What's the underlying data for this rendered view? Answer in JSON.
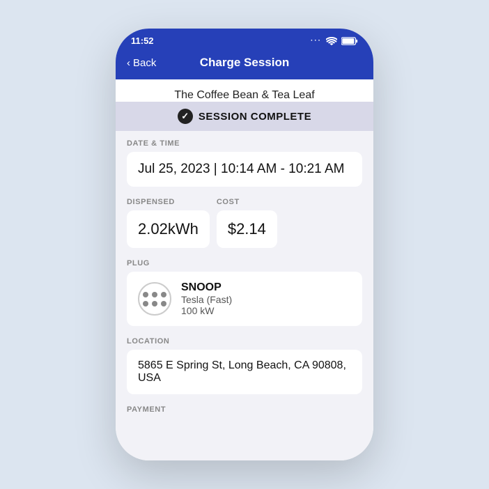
{
  "statusBar": {
    "time": "11:52"
  },
  "navBar": {
    "backLabel": "Back",
    "title": "Charge Session"
  },
  "locationName": "The Coffee Bean & Tea Leaf",
  "sessionBanner": "SESSION COMPLETE",
  "sections": {
    "dateTime": {
      "label": "DATE & TIME",
      "value": "Jul 25, 2023 | 10:14 AM - 10:21 AM"
    },
    "dispensed": {
      "label": "DISPENSED",
      "value": "2.02kWh"
    },
    "cost": {
      "label": "COST",
      "value": "$2.14"
    },
    "plug": {
      "label": "PLUG",
      "name": "SNOOP",
      "type": "Tesla (Fast)",
      "power": "100 kW"
    },
    "location": {
      "label": "LOCATION",
      "value": "5865 E Spring St, Long Beach, CA 90808, USA"
    },
    "payment": {
      "label": "PAYMENT"
    }
  }
}
